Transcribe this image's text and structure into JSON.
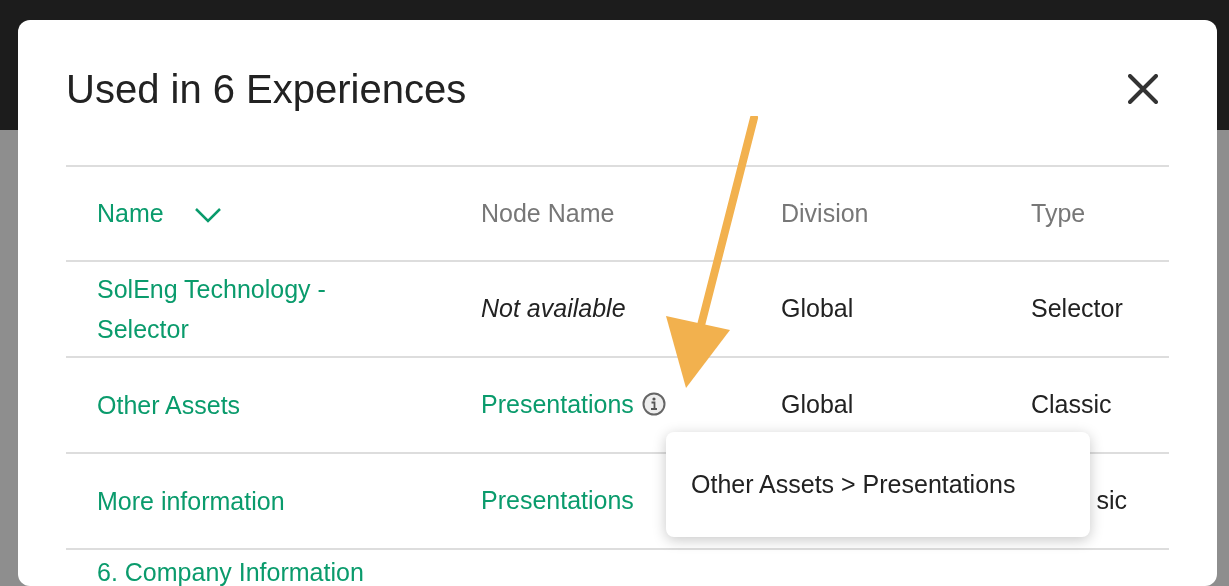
{
  "dialog": {
    "title": "Used in 6 Experiences",
    "columns": [
      {
        "label": "Name",
        "sorted": true
      },
      {
        "label": "Node Name",
        "sorted": false
      },
      {
        "label": "Division",
        "sorted": false
      },
      {
        "label": "Type",
        "sorted": false
      }
    ],
    "rows": [
      {
        "cells": [
          {
            "kind": "link",
            "text": "SolEng Technology - Selector"
          },
          {
            "kind": "missing",
            "text": "Not available"
          },
          {
            "kind": "text",
            "text": "Global"
          },
          {
            "kind": "text",
            "text": "Selector"
          }
        ]
      },
      {
        "cells": [
          {
            "kind": "link",
            "text": "Other Assets"
          },
          {
            "kind": "link",
            "text": "Presentations",
            "info": true
          },
          {
            "kind": "text",
            "text": "Global"
          },
          {
            "kind": "text",
            "text": "Classic"
          }
        ]
      },
      {
        "cells": [
          {
            "kind": "link",
            "text": "More information"
          },
          {
            "kind": "link",
            "text": "Presentations"
          },
          null,
          {
            "kind": "covered",
            "text": "sic"
          }
        ]
      },
      {
        "cells": [
          {
            "kind": "link",
            "text": "6. Company Information"
          }
        ]
      }
    ],
    "tooltip": {
      "text": "Other Assets > Presentations"
    }
  }
}
